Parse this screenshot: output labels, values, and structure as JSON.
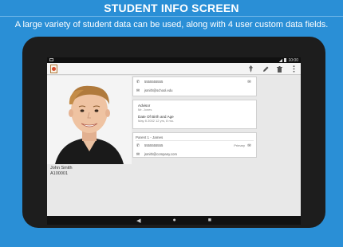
{
  "header": {
    "title": "STUDENT INFO SCREEN",
    "subtitle": "A large variety of student data can be used, along with 4 user custom data fields."
  },
  "statusbar": {
    "time": "10:00"
  },
  "actionbar": {
    "icons": [
      "pin-icon",
      "edit-icon",
      "delete-icon",
      "overflow-menu-icon"
    ]
  },
  "student": {
    "name": "John Smith",
    "id": "A100001"
  },
  "contact_card": {
    "phone": "5555555555",
    "email": "jsmith@school.edu"
  },
  "info_card": {
    "advisor_label": "Advisor",
    "advisor_value": "Mr. Jones",
    "dob_label": "Date Of Birth and Age",
    "dob_value": "May 8 2002    12 yrs, 8 mo."
  },
  "parent_card": {
    "title": "Parent 1 - James",
    "phone": "5555555555",
    "phone_type": "Primary",
    "email": "jsmith@company.com"
  },
  "navbar": {
    "icons": [
      "back-icon",
      "home-icon",
      "recents-icon"
    ]
  },
  "colors": {
    "background": "#2a8fd6",
    "tablet": "#1d1d1d",
    "screen": "#e8e8e8"
  }
}
